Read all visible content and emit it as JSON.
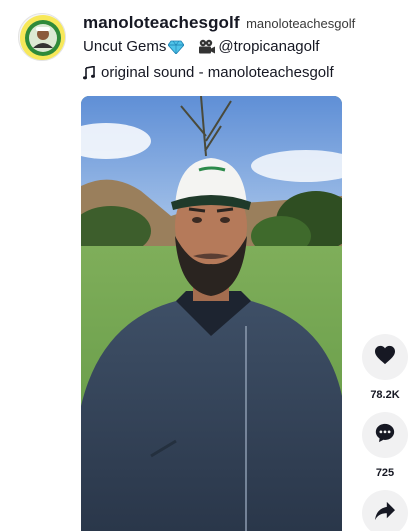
{
  "post": {
    "username": "manoloteachesgolf",
    "nickname": "manoloteachesgolf",
    "caption_text": "Uncut Gems",
    "mention": "@tropicanagolf",
    "sound": "original sound - manoloteachesgolf"
  },
  "actions": {
    "like_count": "78.2K",
    "comment_count": "725"
  },
  "icons": {
    "caption": [
      "gem-icon",
      "film-camera-icon"
    ],
    "sound": "music-note-icon",
    "actions": [
      "heart-icon",
      "comment-icon",
      "share-icon"
    ]
  },
  "colors": {
    "text": "#161823",
    "action_bg": "#f1f1f2",
    "gem": "#4fc3e8"
  }
}
